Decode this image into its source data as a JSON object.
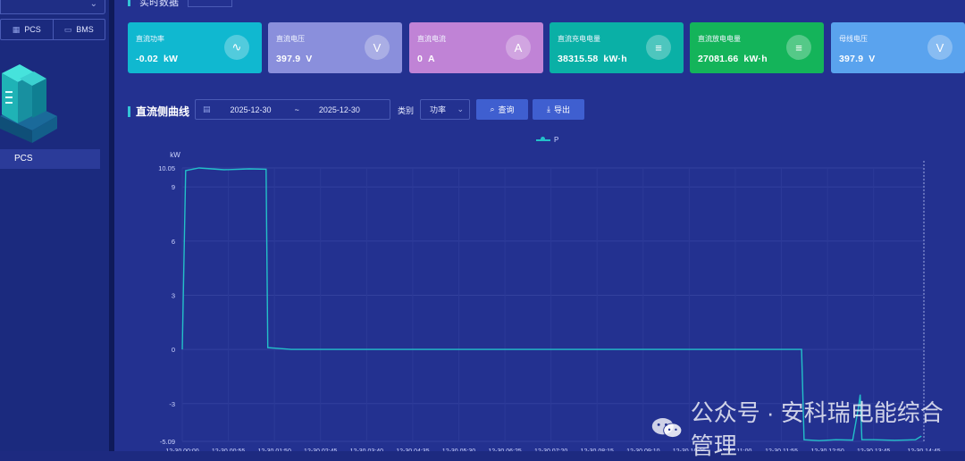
{
  "sidebar": {
    "tabs": [
      {
        "label": "PCS",
        "icon": "monitor-icon"
      },
      {
        "label": "BMS",
        "icon": "battery-icon"
      }
    ],
    "device_item": "PCS"
  },
  "header": {
    "section_title": "实时数据"
  },
  "cards": [
    {
      "label": "直流功率",
      "value": "-0.02",
      "unit": "kW",
      "color": "#10b8d0",
      "icon": "waveform-icon"
    },
    {
      "label": "直流电压",
      "value": "397.9",
      "unit": "V",
      "color": "#8a8fdc",
      "icon": "voltage-icon"
    },
    {
      "label": "直流电流",
      "value": "0",
      "unit": "A",
      "color": "#c083d6",
      "icon": "current-icon"
    },
    {
      "label": "直流充电电量",
      "value": "38315.58",
      "unit": "kW·h",
      "color": "#0ab0a6",
      "icon": "charge-energy-icon"
    },
    {
      "label": "直流放电电量",
      "value": "27081.66",
      "unit": "kW·h",
      "color": "#14b45a",
      "icon": "discharge-energy-icon"
    },
    {
      "label": "母线电压",
      "value": "397.9",
      "unit": "V",
      "color": "#5aa3ee",
      "icon": "bus-voltage-icon"
    }
  ],
  "curve": {
    "title": "直流侧曲线",
    "date_start": "2025-12-30",
    "date_sep": "~",
    "date_end": "2025-12-30",
    "category_label": "类别",
    "category_value": "功率",
    "query_label": "查询",
    "export_label": "导出"
  },
  "chart_data": {
    "type": "line",
    "ylabel": "kW",
    "ylim": [
      -5.09,
      10.05
    ],
    "yticks": [
      10.05,
      9,
      6,
      3,
      0,
      -3,
      -5.09
    ],
    "xticks": [
      "12-30 00:00",
      "12-30 00:55",
      "12-30 01:50",
      "12-30 02:45",
      "12-30 03:40",
      "12-30 04:35",
      "12-30 05:30",
      "12-30 06:25",
      "12-30 07:20",
      "12-30 08:15",
      "12-30 09:10",
      "12-30 10:05",
      "12-30 11:00",
      "12-30 11:55",
      "12-30 12:50",
      "12-30 13:45",
      "12-30 14:45"
    ],
    "series": [
      {
        "name": "P",
        "color": "#23c0c9",
        "points": [
          [
            "12-30 00:00",
            0.0
          ],
          [
            "12-30 00:04",
            9.9
          ],
          [
            "12-30 00:20",
            10.05
          ],
          [
            "12-30 00:50",
            9.95
          ],
          [
            "12-30 01:20",
            10.0
          ],
          [
            "12-30 01:40",
            9.98
          ],
          [
            "12-30 01:42",
            0.1
          ],
          [
            "12-30 02:10",
            0.0
          ],
          [
            "12-30 05:00",
            0.0
          ],
          [
            "12-30 08:00",
            0.0
          ],
          [
            "12-30 11:00",
            0.0
          ],
          [
            "12-30 12:19",
            0.0
          ],
          [
            "12-30 12:22",
            -5.0
          ],
          [
            "12-30 12:40",
            -5.05
          ],
          [
            "12-30 13:00",
            -5.0
          ],
          [
            "12-30 13:20",
            -5.02
          ],
          [
            "12-30 13:27",
            -3.2
          ],
          [
            "12-30 13:29",
            -2.5
          ],
          [
            "12-30 13:31",
            -5.0
          ],
          [
            "12-30 13:45",
            -5.0
          ],
          [
            "12-30 14:10",
            -5.03
          ],
          [
            "12-30 14:35",
            -5.0
          ],
          [
            "12-30 14:42",
            -4.8
          ]
        ]
      }
    ],
    "legend": "top-center",
    "grid": true
  },
  "watermark": {
    "text": "公众号 · 安科瑞电能综合管理"
  }
}
